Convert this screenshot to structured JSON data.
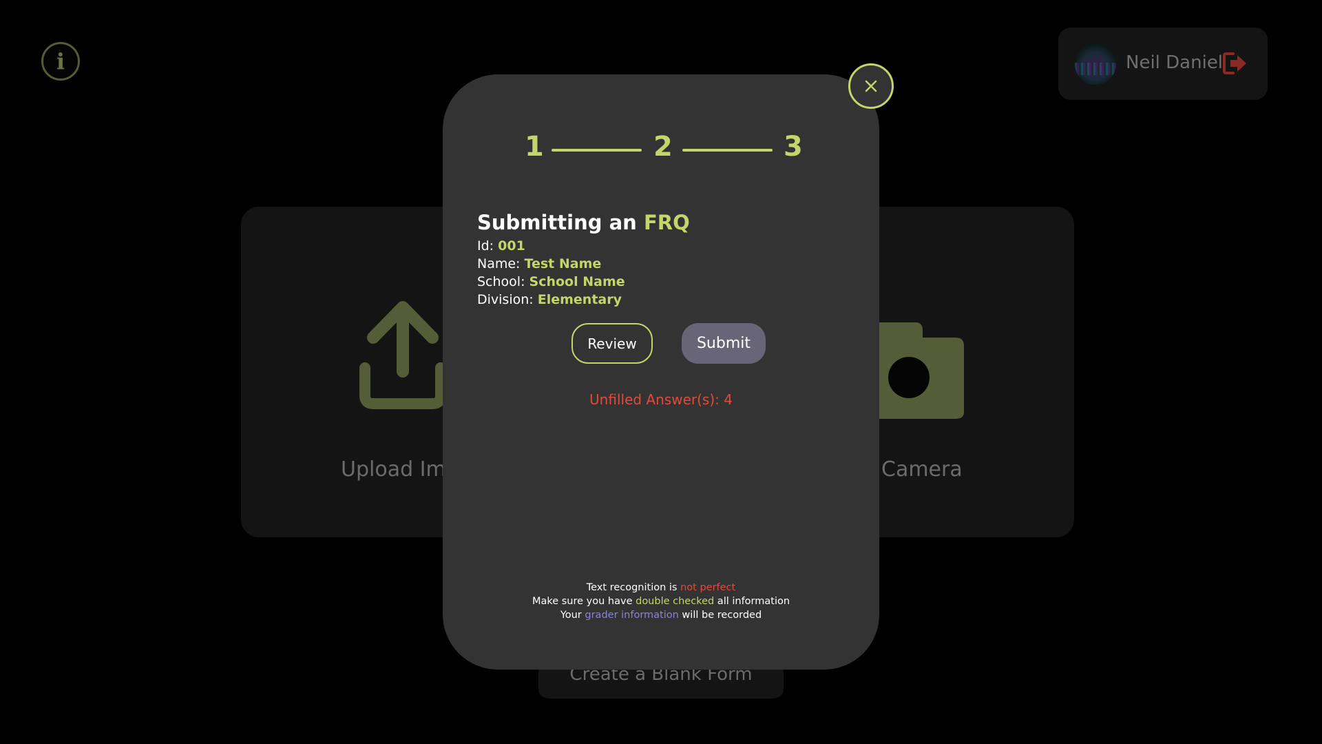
{
  "background": {
    "info_icon": "info-icon",
    "user": {
      "name": "Neil Daniel",
      "avatar": "avatar",
      "logout_icon": "logout-icon"
    },
    "options": {
      "upload_label": "Upload Ima",
      "camera_label": "e Camera",
      "upload_icon": "upload-icon",
      "camera_icon": "camera-icon"
    },
    "blank_form_label": "Create a Blank Form"
  },
  "modal": {
    "close_icon": "close-icon",
    "steps": [
      "1",
      "2",
      "3"
    ],
    "title_prefix": "Submitting an",
    "title_accent": "FRQ",
    "fields": [
      {
        "label": "Id:",
        "value": "001"
      },
      {
        "label": "Name:",
        "value": "Test Name"
      },
      {
        "label": "School:",
        "value": "School Name"
      },
      {
        "label": "Division:",
        "value": "Elementary"
      }
    ],
    "review_label": "Review",
    "submit_label": "Submit",
    "unfilled_text": "Unfilled Answer(s): 4",
    "notes": {
      "line1_a": "Text recognition is ",
      "line1_b": "not perfect",
      "line2_a": "Make sure you have ",
      "line2_b": "double checked",
      "line2_c": " all information",
      "line3_a": "Your ",
      "line3_b": "grader information",
      "line3_c": " will be recorded"
    }
  },
  "colors": {
    "accent": "#c2d66b",
    "warning": "#e24a3b",
    "link": "#8a84d6",
    "modal_bg": "#333333",
    "submit_bg": "#686578"
  }
}
